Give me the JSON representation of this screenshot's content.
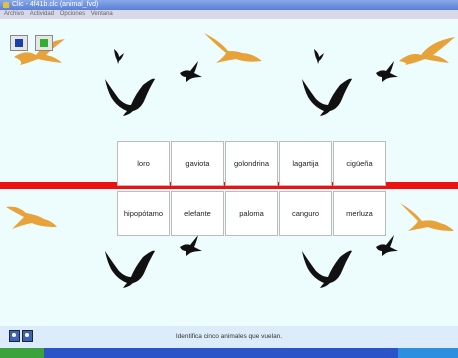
{
  "window": {
    "title": "Clic - 4f41b.clc (animal_fvd)"
  },
  "menubar": {
    "items": [
      "Archivo",
      "Actividad",
      "Opciones",
      "Ventana"
    ]
  },
  "activity": {
    "grid_top": [
      "loro",
      "gaviota",
      "golondrina",
      "lagartija",
      "cigüeña"
    ],
    "grid_bottom": [
      "hipopótamo",
      "elefante",
      "paloma",
      "canguro",
      "merluza"
    ],
    "message": "Identifica cinco animales que vuelan."
  },
  "colors": {
    "stripe": "#ee1111",
    "bird_dark": "#111111",
    "bird_orange": "#e8a23a"
  }
}
